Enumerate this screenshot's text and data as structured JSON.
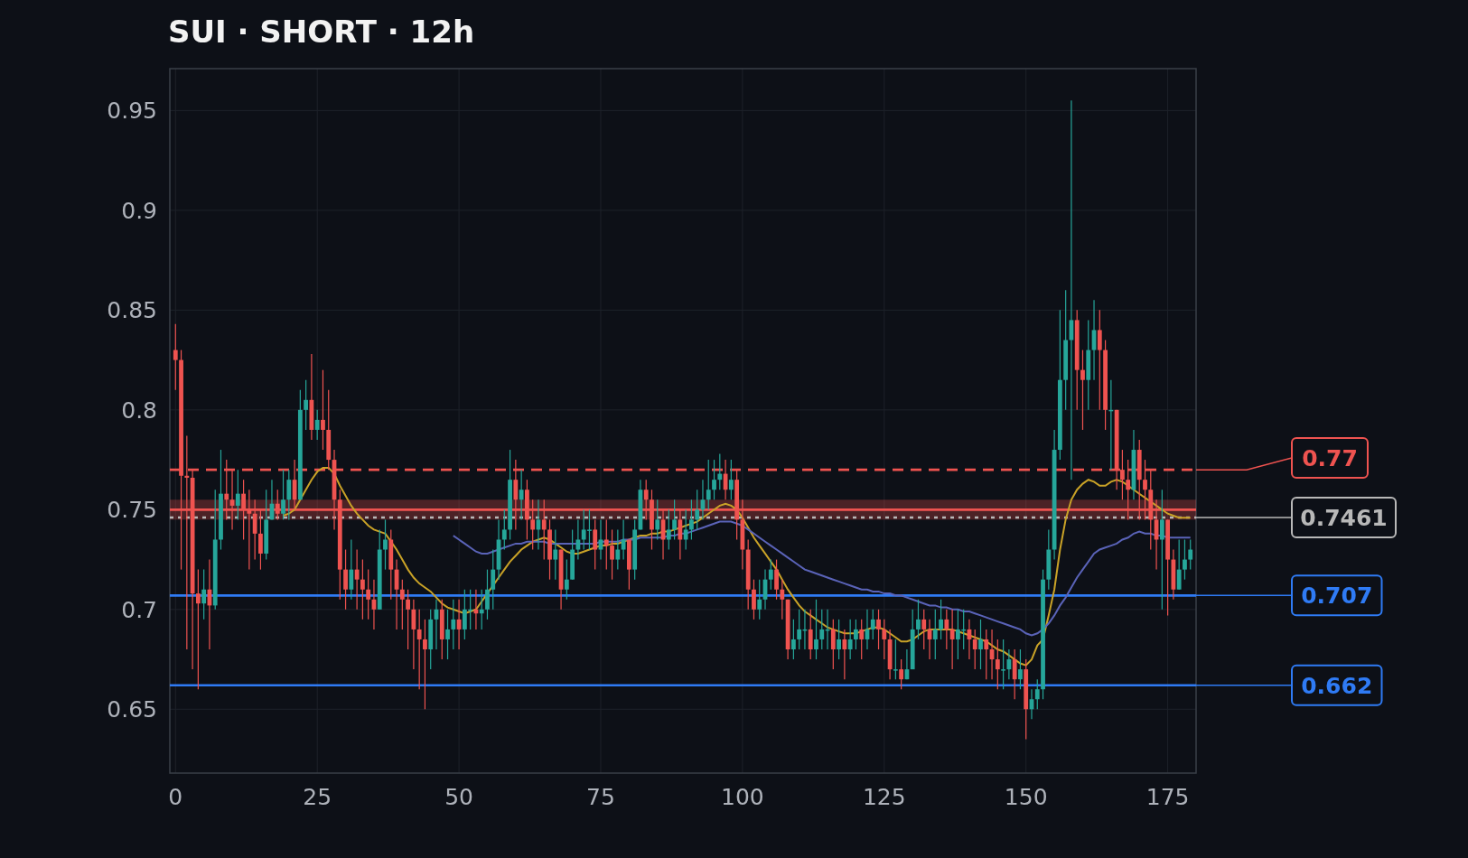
{
  "title": "SUI · SHORT · 12h",
  "chart_data": {
    "type": "candlestick",
    "grid": true,
    "xlim": [
      -1,
      180
    ],
    "ylim": [
      0.618,
      0.971
    ],
    "xticks": [
      0,
      25,
      50,
      75,
      100,
      125,
      150,
      175
    ],
    "yticks": [
      0.65,
      0.7,
      0.75,
      0.8,
      0.85,
      0.9,
      0.95
    ],
    "x": [
      0,
      1,
      2,
      3,
      4,
      5,
      6,
      7,
      8,
      9,
      10,
      11,
      12,
      13,
      14,
      15,
      16,
      17,
      18,
      19,
      20,
      21,
      22,
      23,
      24,
      25,
      26,
      27,
      28,
      29,
      30,
      31,
      32,
      33,
      34,
      35,
      36,
      37,
      38,
      39,
      40,
      41,
      42,
      43,
      44,
      45,
      46,
      47,
      48,
      49,
      50,
      51,
      52,
      53,
      54,
      55,
      56,
      57,
      58,
      59,
      60,
      61,
      62,
      63,
      64,
      65,
      66,
      67,
      68,
      69,
      70,
      71,
      72,
      73,
      74,
      75,
      76,
      77,
      78,
      79,
      80,
      81,
      82,
      83,
      84,
      85,
      86,
      87,
      88,
      89,
      90,
      91,
      92,
      93,
      94,
      95,
      96,
      97,
      98,
      99,
      100,
      101,
      102,
      103,
      104,
      105,
      106,
      107,
      108,
      109,
      110,
      111,
      112,
      113,
      114,
      115,
      116,
      117,
      118,
      119,
      120,
      121,
      122,
      123,
      124,
      125,
      126,
      127,
      128,
      129,
      130,
      131,
      132,
      133,
      134,
      135,
      136,
      137,
      138,
      139,
      140,
      141,
      142,
      143,
      144,
      145,
      146,
      147,
      148,
      149,
      150,
      151,
      152,
      153,
      154,
      155,
      156,
      157,
      158,
      159,
      160,
      161,
      162,
      163,
      164,
      165,
      166,
      167,
      168,
      169,
      170,
      171,
      172,
      173,
      174,
      175,
      176,
      177,
      178,
      179
    ],
    "ohlc": [
      [
        0.83,
        0.843,
        0.81,
        0.825
      ],
      [
        0.825,
        0.83,
        0.72,
        0.767
      ],
      [
        0.767,
        0.787,
        0.68,
        0.766
      ],
      [
        0.766,
        0.77,
        0.67,
        0.708
      ],
      [
        0.708,
        0.72,
        0.66,
        0.703
      ],
      [
        0.703,
        0.72,
        0.695,
        0.71
      ],
      [
        0.71,
        0.725,
        0.68,
        0.702
      ],
      [
        0.702,
        0.76,
        0.7,
        0.735
      ],
      [
        0.735,
        0.78,
        0.73,
        0.758
      ],
      [
        0.758,
        0.775,
        0.745,
        0.755
      ],
      [
        0.755,
        0.77,
        0.74,
        0.752
      ],
      [
        0.752,
        0.77,
        0.745,
        0.758
      ],
      [
        0.758,
        0.765,
        0.735,
        0.75
      ],
      [
        0.75,
        0.76,
        0.72,
        0.748
      ],
      [
        0.748,
        0.755,
        0.725,
        0.738
      ],
      [
        0.738,
        0.75,
        0.72,
        0.728
      ],
      [
        0.728,
        0.76,
        0.725,
        0.745
      ],
      [
        0.745,
        0.765,
        0.745,
        0.753
      ],
      [
        0.753,
        0.76,
        0.745,
        0.748
      ],
      [
        0.748,
        0.77,
        0.745,
        0.755
      ],
      [
        0.755,
        0.77,
        0.745,
        0.765
      ],
      [
        0.765,
        0.775,
        0.75,
        0.755
      ],
      [
        0.755,
        0.81,
        0.755,
        0.8
      ],
      [
        0.8,
        0.815,
        0.79,
        0.805
      ],
      [
        0.805,
        0.828,
        0.785,
        0.79
      ],
      [
        0.79,
        0.8,
        0.785,
        0.795
      ],
      [
        0.795,
        0.82,
        0.78,
        0.79
      ],
      [
        0.79,
        0.81,
        0.77,
        0.775
      ],
      [
        0.775,
        0.78,
        0.74,
        0.755
      ],
      [
        0.755,
        0.76,
        0.705,
        0.72
      ],
      [
        0.72,
        0.73,
        0.7,
        0.71
      ],
      [
        0.71,
        0.735,
        0.705,
        0.72
      ],
      [
        0.72,
        0.73,
        0.7,
        0.715
      ],
      [
        0.715,
        0.725,
        0.695,
        0.71
      ],
      [
        0.71,
        0.72,
        0.695,
        0.705
      ],
      [
        0.705,
        0.715,
        0.69,
        0.7
      ],
      [
        0.7,
        0.74,
        0.7,
        0.73
      ],
      [
        0.73,
        0.745,
        0.72,
        0.735
      ],
      [
        0.735,
        0.74,
        0.705,
        0.72
      ],
      [
        0.72,
        0.725,
        0.69,
        0.71
      ],
      [
        0.71,
        0.715,
        0.69,
        0.705
      ],
      [
        0.705,
        0.71,
        0.68,
        0.7
      ],
      [
        0.7,
        0.705,
        0.67,
        0.69
      ],
      [
        0.69,
        0.7,
        0.66,
        0.685
      ],
      [
        0.685,
        0.695,
        0.65,
        0.68
      ],
      [
        0.68,
        0.7,
        0.67,
        0.695
      ],
      [
        0.695,
        0.705,
        0.68,
        0.7
      ],
      [
        0.7,
        0.705,
        0.675,
        0.685
      ],
      [
        0.685,
        0.7,
        0.675,
        0.69
      ],
      [
        0.69,
        0.705,
        0.68,
        0.695
      ],
      [
        0.695,
        0.705,
        0.68,
        0.69
      ],
      [
        0.69,
        0.71,
        0.685,
        0.7
      ],
      [
        0.7,
        0.71,
        0.69,
        0.7
      ],
      [
        0.7,
        0.71,
        0.69,
        0.698
      ],
      [
        0.698,
        0.71,
        0.69,
        0.7
      ],
      [
        0.7,
        0.72,
        0.695,
        0.71
      ],
      [
        0.71,
        0.73,
        0.7,
        0.72
      ],
      [
        0.72,
        0.745,
        0.715,
        0.735
      ],
      [
        0.735,
        0.75,
        0.73,
        0.74
      ],
      [
        0.74,
        0.78,
        0.735,
        0.765
      ],
      [
        0.765,
        0.775,
        0.74,
        0.755
      ],
      [
        0.755,
        0.77,
        0.745,
        0.76
      ],
      [
        0.76,
        0.765,
        0.735,
        0.745
      ],
      [
        0.745,
        0.755,
        0.73,
        0.74
      ],
      [
        0.74,
        0.755,
        0.73,
        0.745
      ],
      [
        0.745,
        0.755,
        0.725,
        0.74
      ],
      [
        0.74,
        0.745,
        0.715,
        0.725
      ],
      [
        0.725,
        0.74,
        0.715,
        0.73
      ],
      [
        0.73,
        0.73,
        0.7,
        0.71
      ],
      [
        0.71,
        0.725,
        0.705,
        0.715
      ],
      [
        0.715,
        0.74,
        0.715,
        0.73
      ],
      [
        0.73,
        0.745,
        0.725,
        0.735
      ],
      [
        0.735,
        0.75,
        0.73,
        0.74
      ],
      [
        0.74,
        0.75,
        0.73,
        0.74
      ],
      [
        0.74,
        0.745,
        0.72,
        0.73
      ],
      [
        0.73,
        0.745,
        0.725,
        0.735
      ],
      [
        0.735,
        0.745,
        0.72,
        0.732
      ],
      [
        0.732,
        0.74,
        0.715,
        0.725
      ],
      [
        0.725,
        0.74,
        0.72,
        0.73
      ],
      [
        0.73,
        0.745,
        0.725,
        0.735
      ],
      [
        0.735,
        0.735,
        0.71,
        0.72
      ],
      [
        0.72,
        0.745,
        0.715,
        0.74
      ],
      [
        0.74,
        0.765,
        0.74,
        0.76
      ],
      [
        0.76,
        0.765,
        0.745,
        0.755
      ],
      [
        0.755,
        0.76,
        0.73,
        0.74
      ],
      [
        0.74,
        0.755,
        0.735,
        0.745
      ],
      [
        0.745,
        0.75,
        0.725,
        0.735
      ],
      [
        0.735,
        0.75,
        0.73,
        0.74
      ],
      [
        0.74,
        0.755,
        0.735,
        0.745
      ],
      [
        0.745,
        0.75,
        0.725,
        0.735
      ],
      [
        0.735,
        0.75,
        0.73,
        0.74
      ],
      [
        0.74,
        0.755,
        0.735,
        0.745
      ],
      [
        0.745,
        0.76,
        0.74,
        0.75
      ],
      [
        0.75,
        0.765,
        0.745,
        0.755
      ],
      [
        0.755,
        0.775,
        0.75,
        0.76
      ],
      [
        0.76,
        0.775,
        0.755,
        0.765
      ],
      [
        0.765,
        0.778,
        0.76,
        0.768
      ],
      [
        0.768,
        0.775,
        0.755,
        0.76
      ],
      [
        0.76,
        0.775,
        0.755,
        0.765
      ],
      [
        0.765,
        0.77,
        0.735,
        0.745
      ],
      [
        0.745,
        0.755,
        0.72,
        0.73
      ],
      [
        0.73,
        0.735,
        0.7,
        0.71
      ],
      [
        0.71,
        0.715,
        0.695,
        0.7
      ],
      [
        0.7,
        0.715,
        0.695,
        0.705
      ],
      [
        0.705,
        0.72,
        0.7,
        0.715
      ],
      [
        0.715,
        0.725,
        0.71,
        0.72
      ],
      [
        0.72,
        0.725,
        0.705,
        0.71
      ],
      [
        0.71,
        0.715,
        0.695,
        0.705
      ],
      [
        0.705,
        0.705,
        0.675,
        0.68
      ],
      [
        0.68,
        0.695,
        0.675,
        0.685
      ],
      [
        0.685,
        0.7,
        0.68,
        0.69
      ],
      [
        0.69,
        0.7,
        0.68,
        0.69
      ],
      [
        0.69,
        0.7,
        0.675,
        0.68
      ],
      [
        0.68,
        0.705,
        0.675,
        0.685
      ],
      [
        0.685,
        0.7,
        0.68,
        0.69
      ],
      [
        0.69,
        0.7,
        0.68,
        0.69
      ],
      [
        0.69,
        0.695,
        0.67,
        0.68
      ],
      [
        0.68,
        0.695,
        0.675,
        0.685
      ],
      [
        0.685,
        0.69,
        0.665,
        0.68
      ],
      [
        0.68,
        0.695,
        0.675,
        0.685
      ],
      [
        0.685,
        0.695,
        0.68,
        0.69
      ],
      [
        0.69,
        0.695,
        0.675,
        0.685
      ],
      [
        0.685,
        0.7,
        0.68,
        0.69
      ],
      [
        0.69,
        0.7,
        0.685,
        0.695
      ],
      [
        0.695,
        0.7,
        0.68,
        0.69
      ],
      [
        0.69,
        0.695,
        0.675,
        0.685
      ],
      [
        0.685,
        0.69,
        0.665,
        0.67
      ],
      [
        0.67,
        0.685,
        0.665,
        0.67
      ],
      [
        0.67,
        0.675,
        0.66,
        0.665
      ],
      [
        0.665,
        0.68,
        0.665,
        0.67
      ],
      [
        0.67,
        0.7,
        0.67,
        0.69
      ],
      [
        0.69,
        0.705,
        0.685,
        0.695
      ],
      [
        0.695,
        0.7,
        0.68,
        0.69
      ],
      [
        0.69,
        0.695,
        0.675,
        0.685
      ],
      [
        0.685,
        0.7,
        0.675,
        0.69
      ],
      [
        0.69,
        0.705,
        0.685,
        0.695
      ],
      [
        0.695,
        0.7,
        0.68,
        0.69
      ],
      [
        0.69,
        0.7,
        0.67,
        0.685
      ],
      [
        0.685,
        0.7,
        0.675,
        0.69
      ],
      [
        0.69,
        0.7,
        0.68,
        0.69
      ],
      [
        0.69,
        0.695,
        0.675,
        0.685
      ],
      [
        0.685,
        0.69,
        0.67,
        0.68
      ],
      [
        0.68,
        0.695,
        0.67,
        0.685
      ],
      [
        0.685,
        0.69,
        0.665,
        0.68
      ],
      [
        0.68,
        0.69,
        0.665,
        0.675
      ],
      [
        0.675,
        0.685,
        0.66,
        0.67
      ],
      [
        0.67,
        0.685,
        0.66,
        0.67
      ],
      [
        0.67,
        0.68,
        0.665,
        0.675
      ],
      [
        0.675,
        0.68,
        0.655,
        0.665
      ],
      [
        0.665,
        0.68,
        0.66,
        0.67
      ],
      [
        0.67,
        0.675,
        0.635,
        0.65
      ],
      [
        0.65,
        0.66,
        0.645,
        0.655
      ],
      [
        0.655,
        0.665,
        0.65,
        0.66
      ],
      [
        0.66,
        0.72,
        0.655,
        0.715
      ],
      [
        0.715,
        0.74,
        0.71,
        0.73
      ],
      [
        0.73,
        0.79,
        0.725,
        0.78
      ],
      [
        0.78,
        0.85,
        0.775,
        0.815
      ],
      [
        0.815,
        0.86,
        0.8,
        0.835
      ],
      [
        0.835,
        0.955,
        0.765,
        0.845
      ],
      [
        0.845,
        0.85,
        0.8,
        0.82
      ],
      [
        0.82,
        0.83,
        0.79,
        0.815
      ],
      [
        0.815,
        0.845,
        0.8,
        0.83
      ],
      [
        0.83,
        0.855,
        0.815,
        0.84
      ],
      [
        0.84,
        0.85,
        0.8,
        0.83
      ],
      [
        0.83,
        0.835,
        0.79,
        0.8
      ],
      [
        0.8,
        0.815,
        0.77,
        0.8
      ],
      [
        0.8,
        0.8,
        0.76,
        0.77
      ],
      [
        0.77,
        0.78,
        0.755,
        0.765
      ],
      [
        0.765,
        0.775,
        0.745,
        0.76
      ],
      [
        0.76,
        0.79,
        0.755,
        0.78
      ],
      [
        0.78,
        0.785,
        0.745,
        0.765
      ],
      [
        0.765,
        0.775,
        0.745,
        0.76
      ],
      [
        0.76,
        0.77,
        0.73,
        0.745
      ],
      [
        0.745,
        0.755,
        0.72,
        0.735
      ],
      [
        0.735,
        0.76,
        0.7,
        0.745
      ],
      [
        0.745,
        0.745,
        0.697,
        0.725
      ],
      [
        0.725,
        0.73,
        0.705,
        0.71
      ],
      [
        0.71,
        0.735,
        0.71,
        0.72
      ],
      [
        0.72,
        0.735,
        0.715,
        0.725
      ],
      [
        0.725,
        0.735,
        0.72,
        0.73
      ]
    ],
    "series": [
      {
        "type": "line",
        "color": "#c9a227",
        "values": [
          null,
          null,
          null,
          null,
          null,
          null,
          null,
          null,
          null,
          null,
          null,
          null,
          null,
          null,
          null,
          null,
          null,
          null,
          null,
          0.747,
          0.748,
          0.75,
          0.755,
          0.76,
          0.765,
          0.769,
          0.771,
          0.771,
          0.768,
          0.762,
          0.757,
          0.752,
          0.748,
          0.745,
          0.742,
          0.74,
          0.739,
          0.738,
          0.734,
          0.73,
          0.725,
          0.72,
          0.716,
          0.713,
          0.711,
          0.709,
          0.706,
          0.703,
          0.701,
          0.7,
          0.699,
          0.698,
          0.699,
          0.7,
          0.704,
          0.708,
          0.712,
          0.716,
          0.72,
          0.724,
          0.727,
          0.73,
          0.732,
          0.734,
          0.735,
          0.736,
          0.735,
          0.733,
          0.731,
          0.729,
          0.728,
          0.728,
          0.729,
          0.73,
          0.731,
          0.732,
          0.732,
          0.733,
          0.733,
          0.734,
          0.735,
          0.736,
          0.737,
          0.737,
          0.738,
          0.738,
          0.739,
          0.739,
          0.74,
          0.741,
          0.742,
          0.743,
          0.744,
          0.746,
          0.748,
          0.75,
          0.752,
          0.753,
          0.752,
          0.75,
          0.746,
          0.741,
          0.736,
          0.732,
          0.728,
          0.724,
          0.72,
          0.715,
          0.71,
          0.706,
          0.702,
          0.699,
          0.697,
          0.695,
          0.693,
          0.691,
          0.69,
          0.689,
          0.688,
          0.688,
          0.688,
          0.689,
          0.69,
          0.691,
          0.691,
          0.69,
          0.688,
          0.686,
          0.684,
          0.684,
          0.685,
          0.687,
          0.689,
          0.69,
          0.69,
          0.69,
          0.69,
          0.69,
          0.689,
          0.688,
          0.687,
          0.686,
          0.685,
          0.684,
          0.682,
          0.68,
          0.679,
          0.677,
          0.675,
          0.673,
          0.672,
          0.675,
          0.682,
          0.685,
          0.697,
          0.71,
          0.73,
          0.745,
          0.755,
          0.76,
          0.763,
          0.765,
          0.764,
          0.762,
          0.762,
          0.764,
          0.765,
          0.764,
          0.762,
          0.76,
          0.758,
          0.756,
          0.754,
          0.752,
          0.75,
          0.748,
          0.747,
          0.746,
          0.746,
          0.746
        ]
      },
      {
        "type": "line",
        "color": "#5a63b8",
        "values": [
          null,
          null,
          null,
          null,
          null,
          null,
          null,
          null,
          null,
          null,
          null,
          null,
          null,
          null,
          null,
          null,
          null,
          null,
          null,
          null,
          null,
          null,
          null,
          null,
          null,
          null,
          null,
          null,
          null,
          null,
          null,
          null,
          null,
          null,
          null,
          null,
          null,
          null,
          null,
          null,
          null,
          null,
          null,
          null,
          null,
          null,
          null,
          null,
          null,
          0.737,
          0.735,
          0.733,
          0.731,
          0.729,
          0.728,
          0.728,
          0.729,
          0.73,
          0.731,
          0.732,
          0.733,
          0.733,
          0.734,
          0.734,
          0.734,
          0.734,
          0.733,
          0.733,
          0.733,
          0.733,
          0.733,
          0.733,
          0.733,
          0.733,
          0.733,
          0.734,
          0.734,
          0.734,
          0.734,
          0.735,
          0.735,
          0.735,
          0.736,
          0.736,
          0.736,
          0.736,
          0.736,
          0.737,
          0.737,
          0.738,
          0.738,
          0.739,
          0.74,
          0.741,
          0.742,
          0.743,
          0.744,
          0.744,
          0.744,
          0.743,
          0.742,
          0.74,
          0.738,
          0.736,
          0.734,
          0.732,
          0.73,
          0.728,
          0.726,
          0.724,
          0.722,
          0.72,
          0.719,
          0.718,
          0.717,
          0.716,
          0.715,
          0.714,
          0.713,
          0.712,
          0.711,
          0.71,
          0.71,
          0.709,
          0.709,
          0.708,
          0.708,
          0.707,
          0.707,
          0.706,
          0.705,
          0.704,
          0.703,
          0.702,
          0.702,
          0.701,
          0.701,
          0.7,
          0.7,
          0.699,
          0.699,
          0.698,
          0.697,
          0.696,
          0.695,
          0.694,
          0.693,
          0.692,
          0.691,
          0.69,
          0.688,
          0.687,
          0.688,
          0.69,
          0.693,
          0.697,
          0.702,
          0.706,
          0.711,
          0.716,
          0.72,
          0.724,
          0.728,
          0.73,
          0.731,
          0.732,
          0.733,
          0.735,
          0.736,
          0.738,
          0.739,
          0.738,
          0.738,
          0.737,
          0.737,
          0.736,
          0.736,
          0.736,
          0.736,
          0.736
        ]
      }
    ],
    "bands": [
      {
        "axis": "y",
        "from": 0.745,
        "to": 0.755,
        "color": "#ef5350"
      }
    ],
    "ref_lines": [
      {
        "axis": "y",
        "value": 0.77,
        "color": "#ef5350",
        "label": "0.77"
      },
      {
        "axis": "y",
        "value": 0.75,
        "color": "#ef5350"
      },
      {
        "axis": "y",
        "value": 0.7461,
        "color": "#b8b8b8",
        "label": "0.7461"
      },
      {
        "axis": "y",
        "value": 0.707,
        "color": "#2f7bf5",
        "label": "0.707"
      },
      {
        "axis": "y",
        "value": 0.662,
        "color": "#2f7bf5",
        "label": "0.662"
      }
    ]
  }
}
